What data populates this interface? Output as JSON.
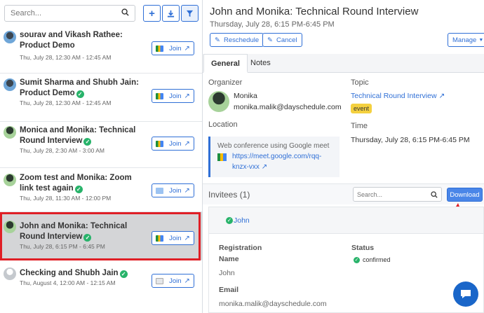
{
  "sidebar": {
    "search_placeholder": "Search...",
    "items": [
      {
        "title": "sourav and Vikash Rathee: Product Demo",
        "time": "Thu, July 28, 12:30 AM - 12:45 AM",
        "join": "Join"
      },
      {
        "title": "Sumit Sharma and Shubh Jain: Product Demo",
        "time": "Thu, July 28, 12:30 AM - 12:45 AM",
        "join": "Join"
      },
      {
        "title": "Monica and Monika: Technical Round Interview",
        "time": "Thu, July 28, 2:30 AM - 3:00 AM",
        "join": "Join"
      },
      {
        "title": "Zoom test and Monika: Zoom link test again",
        "time": "Thu, July 28, 11:30 AM - 12:00 PM",
        "join": "Join"
      },
      {
        "title": "John and Monika: Technical Round Interview",
        "time": "Thu, July 28, 6:15 PM - 6:45 PM",
        "join": "Join"
      },
      {
        "title": "Checking and Shubh Jain",
        "time": "Thu, August 4, 12:00 AM - 12:15 AM",
        "join": "Join"
      }
    ]
  },
  "detail": {
    "title": "John and Monika: Technical Round Interview",
    "subtitle": "Thursday, July 28, 6:15 PM-6:45 PM",
    "reschedule": "Reschedule",
    "cancel": "Cancel",
    "manage": "Manage",
    "tabs": [
      "General",
      "Notes"
    ],
    "organizer_label": "Organizer",
    "organizer_name": "Monika",
    "organizer_email": "monika.malik@dayschedule.com",
    "topic_label": "Topic",
    "topic_value": "Technical Round Interview",
    "topic_badge": "event",
    "location_label": "Location",
    "location_text": "Web conference using Google meet",
    "location_link": "https://meet.google.com/rqq-knzx-vxx",
    "time_label": "Time",
    "time_value": "Thursday, July 28, 6:15 PM-6:45 PM",
    "invitees_label": "Invitees (1)",
    "invitees_search_placeholder": "Search...",
    "download": "Download",
    "invitee_name_short": "John",
    "registration_label": "Registration",
    "name_label": "Name",
    "name_value": "John",
    "status_label": "Status",
    "status_value": "confirmed",
    "email_label": "Email",
    "email_value": "monika.malik@dayschedule.com"
  },
  "colors": {
    "accent": "#2f6fd6",
    "success": "#28b36a",
    "highlight": "#e01f26",
    "badge": "#f4d03f"
  }
}
